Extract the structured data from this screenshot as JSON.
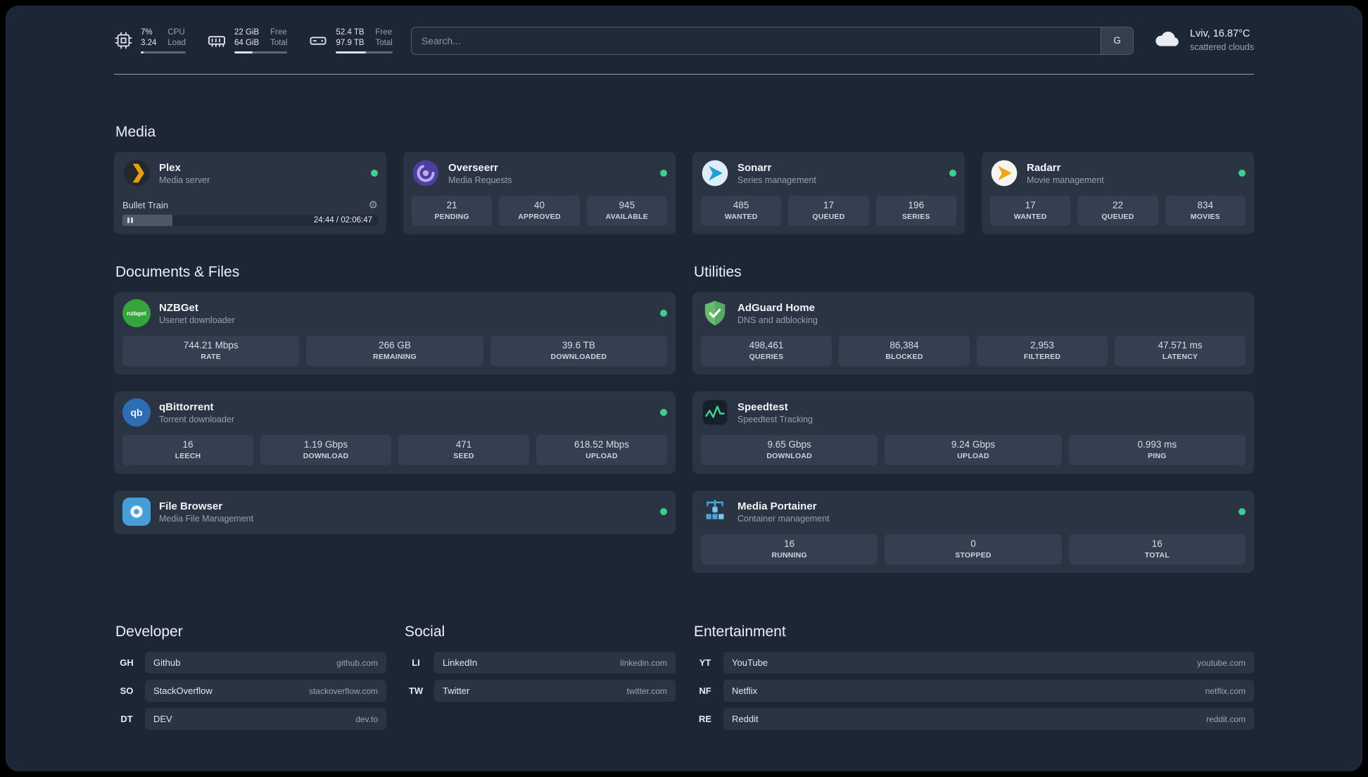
{
  "topbar": {
    "widgets": [
      {
        "name": "cpu",
        "line1": "7%",
        "line2": "3.24",
        "label1": "CPU",
        "label2": "Load",
        "progress": 7
      },
      {
        "name": "memory",
        "line1": "22 GiB",
        "line2": "64 GiB",
        "label1": "Free",
        "label2": "Total",
        "progress": 34
      },
      {
        "name": "disk",
        "line1": "52.4 TB",
        "line2": "97.9 TB",
        "label1": "Free",
        "label2": "Total",
        "progress": 53
      }
    ],
    "search": {
      "placeholder": "Search...",
      "provider": "G"
    },
    "weather": {
      "location": "Lviv, 16.87°C",
      "condition": "scattered clouds"
    }
  },
  "sections": {
    "media": {
      "title": "Media",
      "plex": {
        "name": "Plex",
        "desc": "Media server",
        "now_playing": "Bullet Train",
        "time": "24:44 / 02:06:47",
        "progress": 19.5
      },
      "overseerr": {
        "name": "Overseerr",
        "desc": "Media Requests",
        "stats": [
          {
            "value": "21",
            "label": "PENDING"
          },
          {
            "value": "40",
            "label": "APPROVED"
          },
          {
            "value": "945",
            "label": "AVAILABLE"
          }
        ]
      },
      "sonarr": {
        "name": "Sonarr",
        "desc": "Series management",
        "stats": [
          {
            "value": "485",
            "label": "WANTED"
          },
          {
            "value": "17",
            "label": "QUEUED"
          },
          {
            "value": "196",
            "label": "SERIES"
          }
        ]
      },
      "radarr": {
        "name": "Radarr",
        "desc": "Movie management",
        "stats": [
          {
            "value": "17",
            "label": "WANTED"
          },
          {
            "value": "22",
            "label": "QUEUED"
          },
          {
            "value": "834",
            "label": "MOVIES"
          }
        ]
      }
    },
    "documents": {
      "title": "Documents & Files",
      "nzbget": {
        "name": "NZBGet",
        "desc": "Usenet downloader",
        "icon_text": "nzbget",
        "stats": [
          {
            "value": "744.21 Mbps",
            "label": "RATE"
          },
          {
            "value": "266 GB",
            "label": "REMAINING"
          },
          {
            "value": "39.6 TB",
            "label": "DOWNLOADED"
          }
        ]
      },
      "qbittorrent": {
        "name": "qBittorrent",
        "desc": "Torrent downloader",
        "icon_text": "qb",
        "stats": [
          {
            "value": "16",
            "label": "LEECH"
          },
          {
            "value": "1.19 Gbps",
            "label": "DOWNLOAD"
          },
          {
            "value": "471",
            "label": "SEED"
          },
          {
            "value": "618.52 Mbps",
            "label": "UPLOAD"
          }
        ]
      },
      "filebrowser": {
        "name": "File Browser",
        "desc": "Media File Management"
      }
    },
    "utilities": {
      "title": "Utilities",
      "adguard": {
        "name": "AdGuard Home",
        "desc": "DNS and adblocking",
        "stats": [
          {
            "value": "498,461",
            "label": "QUERIES"
          },
          {
            "value": "86,384",
            "label": "BLOCKED"
          },
          {
            "value": "2,953",
            "label": "FILTERED"
          },
          {
            "value": "47.571 ms",
            "label": "LATENCY"
          }
        ]
      },
      "speedtest": {
        "name": "Speedtest",
        "desc": "Speedtest Tracking",
        "stats": [
          {
            "value": "9.65 Gbps",
            "label": "DOWNLOAD"
          },
          {
            "value": "9.24 Gbps",
            "label": "UPLOAD"
          },
          {
            "value": "0.993 ms",
            "label": "PING"
          }
        ]
      },
      "portainer": {
        "name": "Media Portainer",
        "desc": "Container management",
        "stats": [
          {
            "value": "16",
            "label": "RUNNING"
          },
          {
            "value": "0",
            "label": "STOPPED"
          },
          {
            "value": "16",
            "label": "TOTAL"
          }
        ]
      }
    }
  },
  "bookmarks": [
    {
      "title": "Developer",
      "items": [
        {
          "abbr": "GH",
          "name": "Github",
          "url": "github.com"
        },
        {
          "abbr": "SO",
          "name": "StackOverflow",
          "url": "stackoverflow.com"
        },
        {
          "abbr": "DT",
          "name": "DEV",
          "url": "dev.to"
        }
      ]
    },
    {
      "title": "Social",
      "items": [
        {
          "abbr": "LI",
          "name": "LinkedIn",
          "url": "linkedin.com"
        },
        {
          "abbr": "TW",
          "name": "Twitter",
          "url": "twitter.com"
        }
      ]
    },
    {
      "title": "Entertainment",
      "items": [
        {
          "abbr": "YT",
          "name": "YouTube",
          "url": "youtube.com"
        },
        {
          "abbr": "NF",
          "name": "Netflix",
          "url": "netflix.com"
        },
        {
          "abbr": "RE",
          "name": "Reddit",
          "url": "reddit.com"
        }
      ]
    }
  ]
}
